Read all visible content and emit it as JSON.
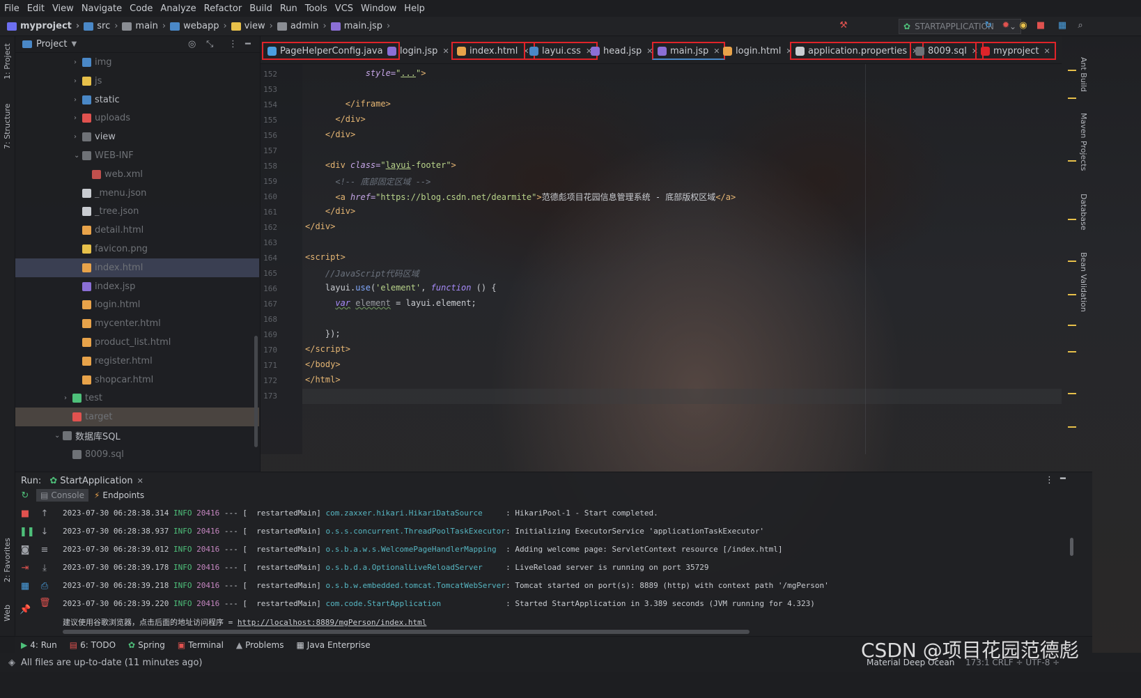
{
  "menu": [
    "File",
    "Edit",
    "View",
    "Navigate",
    "Code",
    "Analyze",
    "Refactor",
    "Build",
    "Run",
    "Tools",
    "VCS",
    "Window",
    "Help"
  ],
  "breadcrumb": [
    "myproject",
    "src",
    "main",
    "webapp",
    "view",
    "admin",
    "main.jsp"
  ],
  "run_config": "STARTAPPLICATION",
  "left_stripe": {
    "project": "1: Project",
    "structure": "7: Structure",
    "favorites": "2: Favorites",
    "web": "Web"
  },
  "project": {
    "title": "Project",
    "tree": [
      {
        "label": "img",
        "dim": true,
        "arrow": "›",
        "indent": 1
      },
      {
        "label": "js",
        "dim": true,
        "arrow": "›",
        "indent": 1
      },
      {
        "label": "static",
        "dim": false,
        "arrow": "›",
        "indent": 1
      },
      {
        "label": "uploads",
        "dim": true,
        "arrow": "›",
        "indent": 1
      },
      {
        "label": "view",
        "dim": false,
        "arrow": "›",
        "indent": 1
      },
      {
        "label": "WEB-INF",
        "dim": true,
        "arrow": "⌄",
        "indent": 1
      },
      {
        "label": "web.xml",
        "dim": true,
        "arrow": "",
        "indent": 2
      },
      {
        "label": "_menu.json",
        "dim": true,
        "arrow": "",
        "indent": 1
      },
      {
        "label": "_tree.json",
        "dim": true,
        "arrow": "",
        "indent": 1
      },
      {
        "label": "detail.html",
        "dim": true,
        "arrow": "",
        "indent": 1
      },
      {
        "label": "favicon.png",
        "dim": true,
        "arrow": "",
        "indent": 1
      },
      {
        "label": "index.html",
        "dim": true,
        "arrow": "",
        "indent": 1
      },
      {
        "label": "index.jsp",
        "dim": true,
        "arrow": "",
        "indent": 1
      },
      {
        "label": "login.html",
        "dim": true,
        "arrow": "",
        "indent": 1
      },
      {
        "label": "mycenter.html",
        "dim": true,
        "arrow": "",
        "indent": 1
      },
      {
        "label": "product_list.html",
        "dim": true,
        "arrow": "",
        "indent": 1
      },
      {
        "label": "register.html",
        "dim": true,
        "arrow": "",
        "indent": 1
      },
      {
        "label": "shopcar.html",
        "dim": true,
        "arrow": "",
        "indent": 1
      },
      {
        "label": "test",
        "dim": true,
        "arrow": "›",
        "indent": 0
      },
      {
        "label": "target",
        "dim": true,
        "arrow": "",
        "indent": 0
      },
      {
        "label": "数据库SQL",
        "dim": false,
        "arrow": "⌄",
        "indent": -1
      },
      {
        "label": "8009.sql",
        "dim": true,
        "arrow": "",
        "indent": 0
      }
    ]
  },
  "tabs": [
    {
      "label": "PageHelperConfig.java",
      "boxed": true
    },
    {
      "label": "login.jsp",
      "boxed": false
    },
    {
      "label": "index.html",
      "boxed": true
    },
    {
      "label": "layui.css",
      "boxed": true
    },
    {
      "label": "head.jsp",
      "boxed": false
    },
    {
      "label": "main.jsp",
      "boxed": true
    },
    {
      "label": "login.html",
      "boxed": false
    },
    {
      "label": "application.properties",
      "boxed": true
    },
    {
      "label": "8009.sql",
      "boxed": true
    },
    {
      "label": "myproject",
      "boxed": true
    }
  ],
  "editor": {
    "line_numbers": [
      "152",
      "153",
      "154",
      "155",
      "156",
      "157",
      "158",
      "159",
      "160",
      "161",
      "162",
      "163",
      "164",
      "165",
      "166",
      "167",
      "168",
      "169",
      "170",
      "171",
      "172",
      "173"
    ]
  },
  "right_stripe": [
    "Ant Build",
    "Maven Projects",
    "Database",
    "Bean Validation"
  ],
  "run": {
    "label": "Run:",
    "config_tab": "StartApplication",
    "sub_tabs": [
      "Console",
      "Endpoints"
    ],
    "logs": [
      {
        "ts": "2023-07-30 06:28:38.314",
        "level": "INFO",
        "pid": "20416",
        "thread": "--- [  restartedMain]",
        "logger": "com.zaxxer.hikari.HikariDataSource",
        "msg": ": HikariPool-1 - Start completed."
      },
      {
        "ts": "2023-07-30 06:28:38.937",
        "level": "INFO",
        "pid": "20416",
        "thread": "--- [  restartedMain]",
        "logger": "o.s.s.concurrent.ThreadPoolTaskExecutor",
        "msg": ": Initializing ExecutorService 'applicationTaskExecutor'"
      },
      {
        "ts": "2023-07-30 06:28:39.012",
        "level": "INFO",
        "pid": "20416",
        "thread": "--- [  restartedMain]",
        "logger": "o.s.b.a.w.s.WelcomePageHandlerMapping",
        "msg": ": Adding welcome page: ServletContext resource [/index.html]"
      },
      {
        "ts": "2023-07-30 06:28:39.178",
        "level": "INFO",
        "pid": "20416",
        "thread": "--- [  restartedMain]",
        "logger": "o.s.b.d.a.OptionalLiveReloadServer",
        "msg": ": LiveReload server is running on port 35729"
      },
      {
        "ts": "2023-07-30 06:28:39.218",
        "level": "INFO",
        "pid": "20416",
        "thread": "--- [  restartedMain]",
        "logger": "o.s.b.w.embedded.tomcat.TomcatWebServer",
        "msg": ": Tomcat started on port(s): 8889 (http) with context path '/mgPerson'"
      },
      {
        "ts": "2023-07-30 06:28:39.220",
        "level": "INFO",
        "pid": "20416",
        "thread": "--- [  restartedMain]",
        "logger": "com.code.StartApplication",
        "msg": ": Started StartApplication in 3.389 seconds (JVM running for 4.323)"
      }
    ],
    "hint_text": "建议使用谷歌浏览器，点击后面的地址访问程序 = ",
    "hint_link": "http://localhost:8889/mgPerson/index.html"
  },
  "bottom_tools": [
    "4: Run",
    "6: TODO",
    "Spring",
    "Terminal",
    "Problems",
    "Java Enterprise"
  ],
  "status": {
    "message": "All files are up-to-date (11 minutes ago)",
    "theme": "Material Deep Ocean",
    "position": "173:1  CRLF ÷  UTF-8 ÷",
    "watermark": "CSDN @项目花园范德彪"
  },
  "colors": {
    "highlight_box": "#e0242a",
    "accent": "#4a88c7",
    "info": "#4ec07a"
  }
}
